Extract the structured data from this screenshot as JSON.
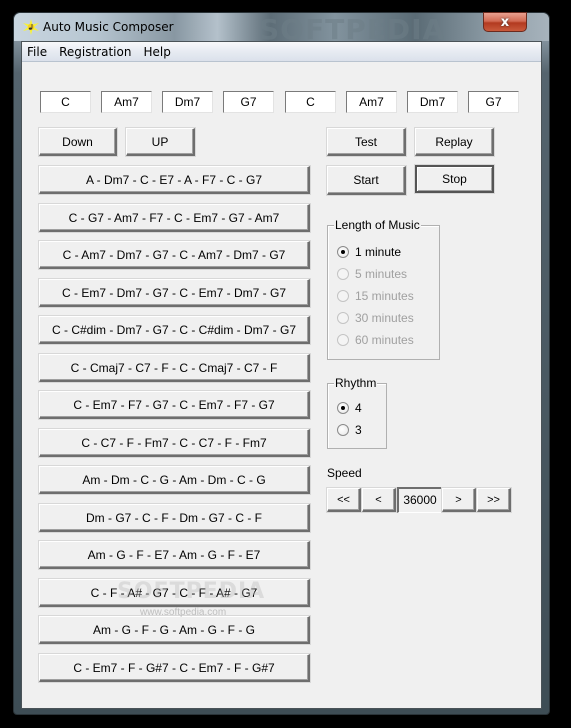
{
  "window": {
    "title": "Auto Music Composer",
    "close_label": "x",
    "watermark": "SOFTPEDIA"
  },
  "menu": {
    "items": [
      {
        "label": "File"
      },
      {
        "label": "Registration"
      },
      {
        "label": "Help"
      }
    ]
  },
  "chords": [
    "C",
    "Am7",
    "Dm7",
    "G7",
    "C",
    "Am7",
    "Dm7",
    "G7"
  ],
  "transpose": {
    "down_label": "Down",
    "up_label": "UP"
  },
  "progressions": [
    "A - Dm7 - C - E7 - A - F7 - C - G7",
    "C - G7 - Am7 - F7 - C - Em7 - G7 - Am7",
    "C - Am7 - Dm7 - G7 - C - Am7 - Dm7 - G7",
    "C - Em7 - Dm7 - G7 - C - Em7 - Dm7 - G7",
    "C - C#dim - Dm7 - G7 - C - C#dim - Dm7 - G7",
    "C - Cmaj7 - C7 - F - C - Cmaj7 - C7 - F",
    "C - Em7 - F7 - G7 - C - Em7 - F7 - G7",
    "C - C7 - F - Fm7 - C - C7 - F - Fm7",
    "Am - Dm - C - G - Am - Dm - C - G",
    "Dm - G7 - C - F - Dm - G7 - C - F",
    "Am - G - F - E7 - Am - G - F - E7",
    "C - F - A# - G7 - C - F - A# - G7",
    "Am - G - F - G - Am - G - F - G",
    "C - Em7 - F - G#7 - C - Em7 - F - G#7"
  ],
  "controls": {
    "test_label": "Test",
    "replay_label": "Replay",
    "start_label": "Start",
    "stop_label": "Stop"
  },
  "length_of_music": {
    "label": "Length of Music",
    "selected": "1 minute",
    "options": [
      {
        "label": "1 minute",
        "checked": true,
        "enabled": true
      },
      {
        "label": "5 minutes",
        "checked": false,
        "enabled": false
      },
      {
        "label": "15 minutes",
        "checked": false,
        "enabled": false
      },
      {
        "label": "30 minutes",
        "checked": false,
        "enabled": false
      },
      {
        "label": "60 minutes",
        "checked": false,
        "enabled": false
      }
    ]
  },
  "rhythm": {
    "label": "Rhythm",
    "selected": "4",
    "options": [
      {
        "label": "4",
        "checked": true
      },
      {
        "label": "3",
        "checked": false
      }
    ]
  },
  "speed": {
    "label": "Speed",
    "value": "36000",
    "fast_back_label": "<<",
    "back_label": "<",
    "forward_label": ">",
    "fast_forward_label": ">>"
  },
  "watermark": {
    "center": "SOFTPEDIA",
    "url": "www.softpedia.com"
  }
}
